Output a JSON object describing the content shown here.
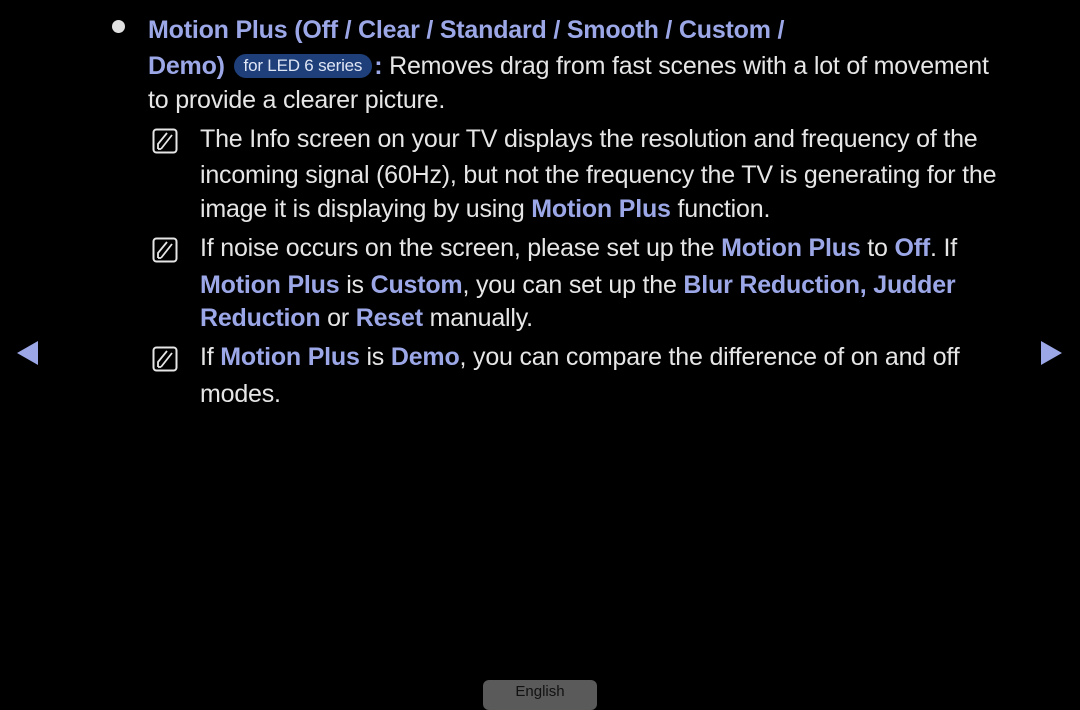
{
  "colors": {
    "highlight": "#9ba7e6",
    "text": "#e6e6e6",
    "badge_bg": "#1f3f7a",
    "arrow": "#9ba7e6"
  },
  "item": {
    "title_1": "Motion Plus (Off / Clear / Standard / Smooth / Custom /",
    "title_2": "Demo)",
    "badge": "for LED 6 series",
    "colon": ":",
    "desc_1": " Removes drag from fast scenes with a lot of movement",
    "desc_2": "to provide a clearer picture."
  },
  "notes": [
    {
      "icon": "note-icon",
      "l1": "The Info screen on your TV displays the resolution and frequency of the",
      "l2": "incoming signal (60Hz), but not the frequency the TV is generating for the",
      "l3a": "image it is displaying by using ",
      "l3b": "Motion Plus",
      "l3c": " function."
    },
    {
      "icon": "note-icon",
      "l1a": "If noise occurs on the screen, please set up the ",
      "l1b": "Motion Plus",
      "l1c": " to ",
      "l1d": "Off",
      "l1e": ". If",
      "l2a": "Motion Plus",
      "l2b": " is ",
      "l2c": "Custom",
      "l2d": ", you can set up the ",
      "l2e": "Blur Reduction, Judder",
      "l3a": "Reduction",
      "l3b": " or ",
      "l3c": "Reset",
      "l3d": " manually."
    },
    {
      "icon": "note-icon",
      "l1a": "If ",
      "l1b": "Motion Plus",
      "l1c": " is ",
      "l1d": "Demo",
      "l1e": ", you can compare the difference of on and off",
      "l2": "modes."
    }
  ],
  "nav": {
    "prev": "previous-page",
    "next": "next-page"
  },
  "language_button": "English"
}
